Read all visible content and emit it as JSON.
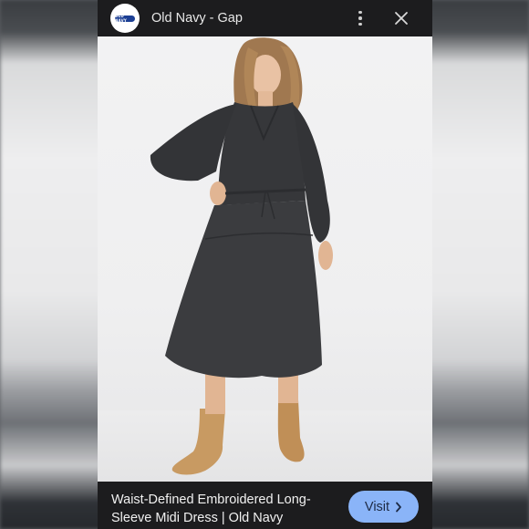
{
  "header": {
    "source_title": "Old Navy - Gap",
    "logo_text": "OLD NAVY",
    "more_icon": "more-vert-icon",
    "close_icon": "close-icon"
  },
  "image": {
    "subject": "woman wearing dark tiered long-sleeve midi dress with tan ankle boots"
  },
  "footer": {
    "product_title": "Waist-Defined Embroidered Long-Sleeve Midi Dress | Old Navy",
    "visit_label": "Visit",
    "visit_icon": "chevron-right-icon"
  },
  "colors": {
    "bar_bg": "#1c1c1e",
    "visit_button": "#8ab4f8",
    "dress": "#3b3c3f",
    "boots": "#c89a62"
  }
}
